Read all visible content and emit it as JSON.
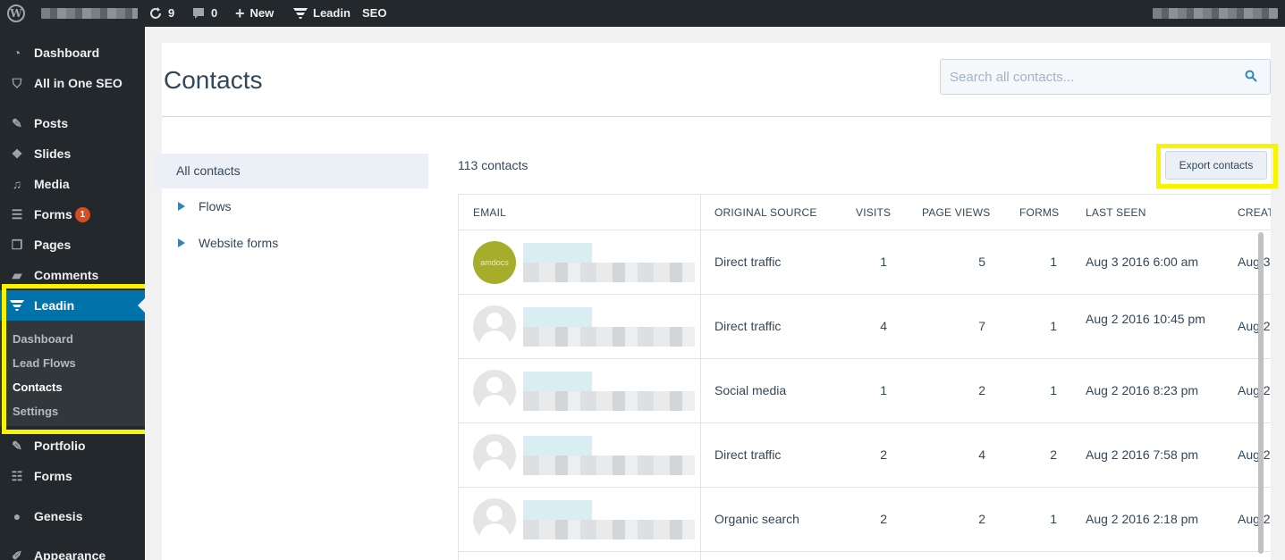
{
  "adminbar": {
    "updates_count": "9",
    "comments_count": "0",
    "new_label": "New",
    "leadin_label": "Leadin",
    "seo_label": "SEO"
  },
  "sidebar": {
    "items": [
      {
        "label": "Dashboard",
        "icon": "dashboard-icon"
      },
      {
        "label": "All in One SEO",
        "icon": "shield-icon"
      },
      {
        "label": "Posts",
        "icon": "pin-icon"
      },
      {
        "label": "Slides",
        "icon": "slides-icon"
      },
      {
        "label": "Media",
        "icon": "media-icon"
      },
      {
        "label": "Forms",
        "icon": "forms-icon",
        "badge": "1"
      },
      {
        "label": "Pages",
        "icon": "pages-icon"
      },
      {
        "label": "Comments",
        "icon": "comments-icon"
      },
      {
        "label": "Leadin",
        "icon": "leadin-icon"
      },
      {
        "label": "Portfolio",
        "icon": "pin-icon"
      },
      {
        "label": "Forms",
        "icon": "list-icon"
      },
      {
        "label": "Genesis",
        "icon": "genesis-icon"
      },
      {
        "label": "Appearance",
        "icon": "brush-icon"
      }
    ],
    "submenu": [
      "Dashboard",
      "Lead Flows",
      "Contacts",
      "Settings"
    ]
  },
  "page": {
    "title": "Contacts",
    "search_placeholder": "Search all contacts...",
    "count": "113 contacts",
    "export_label": "Export contacts"
  },
  "filters": {
    "all": "All contacts",
    "items": [
      "Flows",
      "Website forms"
    ]
  },
  "table": {
    "headers": [
      "EMAIL",
      "ORIGINAL SOURCE",
      "VISITS",
      "PAGE VIEWS",
      "FORMS",
      "LAST SEEN",
      "CREAT"
    ],
    "rows": [
      {
        "avatar": "amdocs",
        "source": "Direct traffic",
        "visits": "1",
        "page_views": "5",
        "forms": "1",
        "last_seen": "Aug 3 2016 6:00 am",
        "created": "Aug 3"
      },
      {
        "avatar": "",
        "source": "Direct traffic",
        "visits": "4",
        "page_views": "7",
        "forms": "1",
        "last_seen": "Aug 2 2016 10:45 pm",
        "created": "Aug 2"
      },
      {
        "avatar": "",
        "source": "Social media",
        "visits": "1",
        "page_views": "2",
        "forms": "1",
        "last_seen": "Aug 2 2016 8:23 pm",
        "created": "Aug 2"
      },
      {
        "avatar": "",
        "source": "Direct traffic",
        "visits": "2",
        "page_views": "4",
        "forms": "2",
        "last_seen": "Aug 2 2016 7:58 pm",
        "created": "Aug 2"
      },
      {
        "avatar": "",
        "source": "Organic search",
        "visits": "2",
        "page_views": "2",
        "forms": "1",
        "last_seen": "Aug 2 2016 2:18 pm",
        "created": "Aug 2"
      }
    ]
  },
  "colors": {
    "admin_bg": "#23282d",
    "active_menu": "#0073aa",
    "highlight": "#f8f400",
    "accent_blue": "#2e86c1",
    "text": "#33475b"
  }
}
